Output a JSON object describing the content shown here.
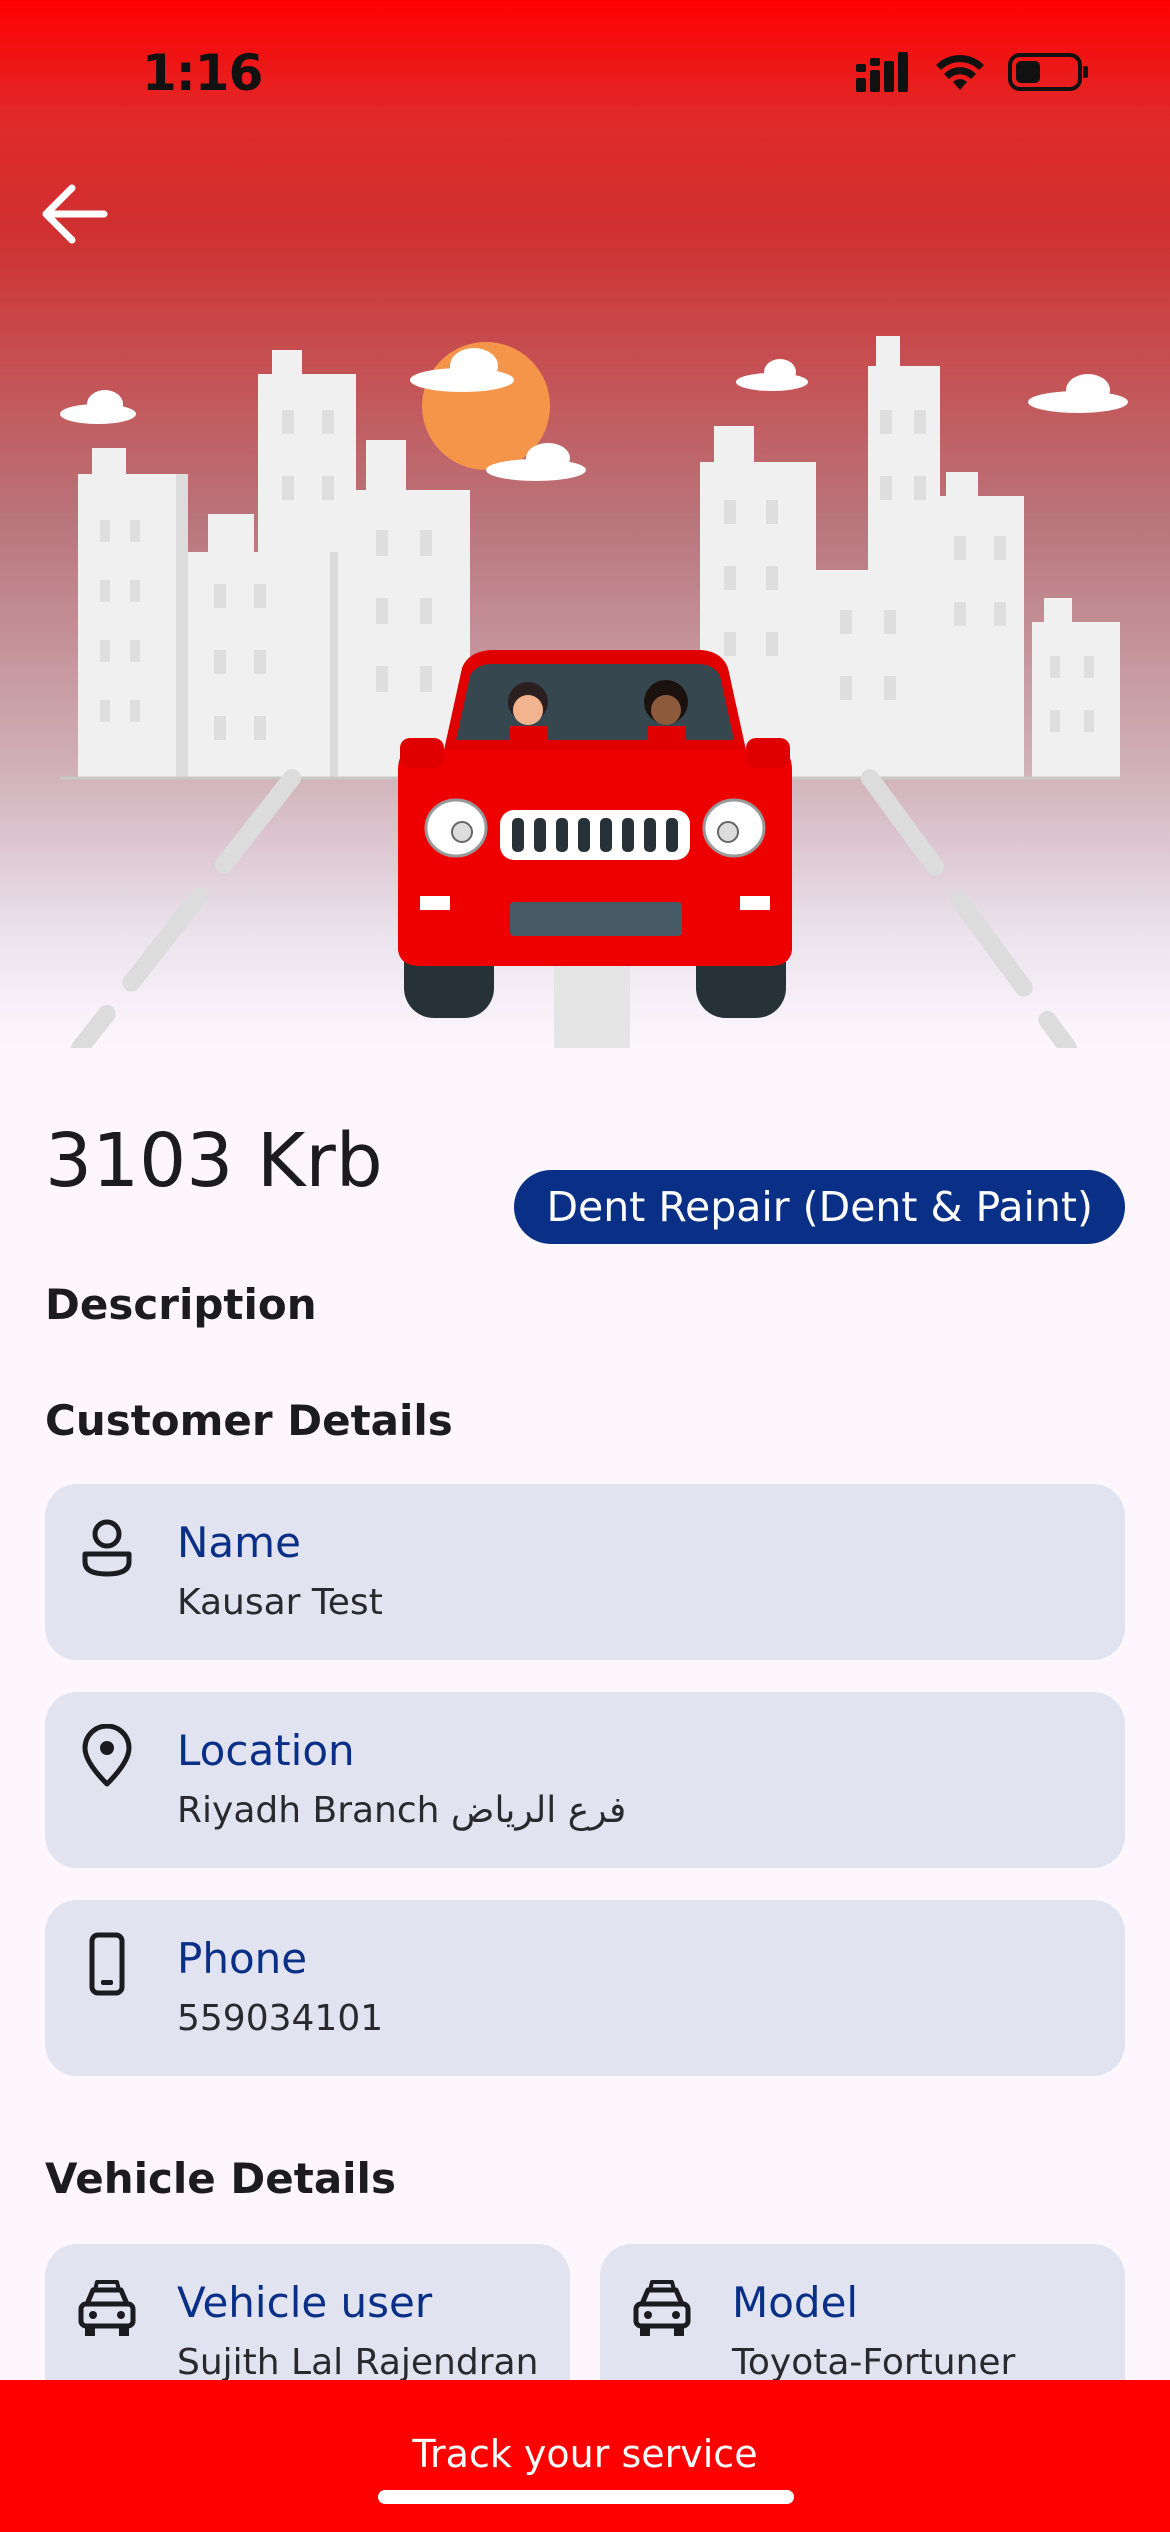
{
  "status_bar": {
    "time": "1:16"
  },
  "ticket": {
    "title": "3103 Krb",
    "service_type": "Dent Repair (Dent & Paint)"
  },
  "sections": {
    "description": "Description",
    "customer_details": "Customer Details",
    "vehicle_details": "Vehicle Details"
  },
  "customer": {
    "name_label": "Name",
    "name_value": "Kausar Test",
    "location_label": "Location",
    "location_value": "Riyadh Branch فرع الرياض",
    "phone_label": "Phone",
    "phone_value": "559034101"
  },
  "vehicle": {
    "user_label": "Vehicle user",
    "user_value": "Sujith Lal Rajendran",
    "model_label": "Model",
    "model_value": "Toyota-Fortuner"
  },
  "footer": {
    "track_label": "Track your service"
  },
  "colors": {
    "brand_red": "#ff0000",
    "accent_navy": "#0a2f86",
    "card_bg": "#e2e3f1"
  },
  "icons": [
    "back-arrow-icon",
    "person-icon",
    "location-pin-icon",
    "phone-icon",
    "car-icon"
  ]
}
